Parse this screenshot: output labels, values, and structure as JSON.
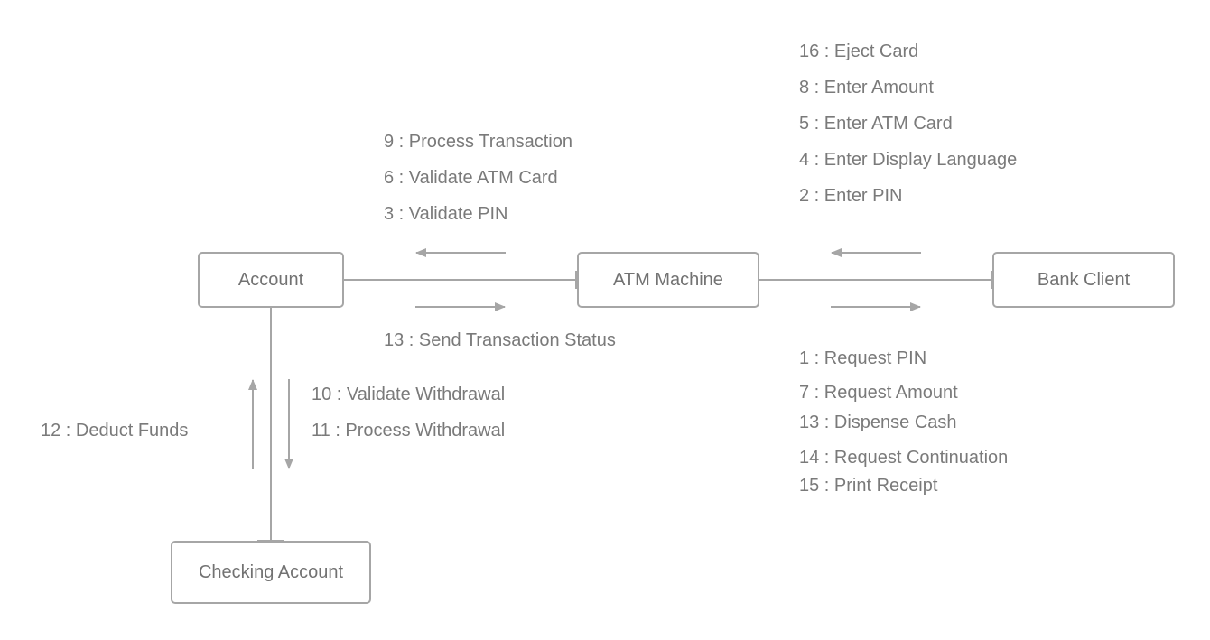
{
  "nodes": {
    "account": "Account",
    "atm": "ATM Machine",
    "client": "Bank Client",
    "checking": "Checking Account"
  },
  "messages": {
    "atm_to_account": [
      "9 : Process Transaction",
      "6 : Validate ATM Card",
      "3 : Validate PIN"
    ],
    "account_to_atm": [
      "13 : Send Transaction Status"
    ],
    "client_to_atm": [
      "16 : Eject Card",
      "8 : Enter Amount",
      "5 : Enter ATM Card",
      "4 : Enter Display Language",
      "2 : Enter PIN"
    ],
    "atm_to_client": [
      "1 : Request PIN",
      "7 : Request Amount",
      "13 : Dispense Cash",
      "14 : Request Continuation",
      "15 : Print Receipt"
    ],
    "account_to_checking": [
      "10 : Validate Withdrawal",
      "11 : Process Withdrawal"
    ],
    "checking_to_account": [
      "12 : Deduct Funds"
    ]
  },
  "colors": {
    "line": "#a6a6a6",
    "text": "#7a7a7a"
  }
}
